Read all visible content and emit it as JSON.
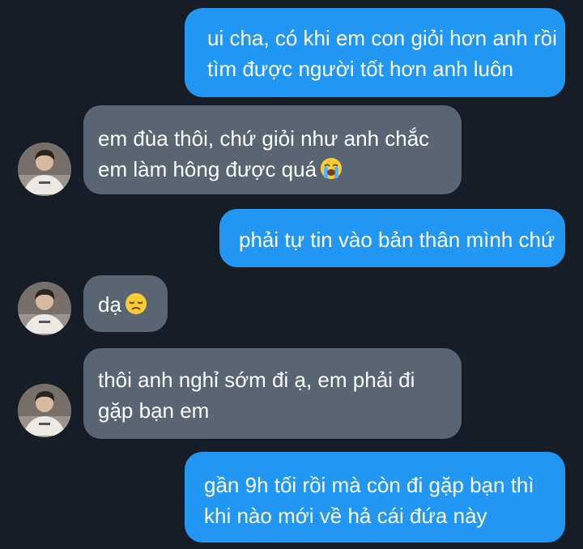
{
  "messages": [
    {
      "side": "out",
      "lines": [
        "ui cha, có khi em con giỏi hơn anh rồi",
        "tìm được người tốt hơn anh luôn"
      ]
    },
    {
      "side": "in",
      "lines": [
        "em đùa thôi, chứ giỏi như anh chắc",
        "em làm hông được quá"
      ],
      "emoji": "loudly-crying-face-emoji"
    },
    {
      "side": "out",
      "lines": [
        "phải tự tin vào bản thân mình chứ"
      ]
    },
    {
      "side": "in",
      "lines": [
        "dạ"
      ],
      "emoji": "disappointed-face-emoji"
    },
    {
      "side": "in",
      "lines": [
        "thôi anh nghỉ sớm đi ạ, em phải đi",
        "gặp bạn em"
      ]
    },
    {
      "side": "out",
      "lines": [
        "gần 9h tối rồi mà còn đi gặp bạn thì",
        "khi nào mới về hả cái đứa này"
      ]
    }
  ],
  "colors": {
    "background": "#161d27",
    "outgoing_bubble": "#2196f3",
    "incoming_bubble": "#5a6573",
    "text": "#ffffff"
  }
}
